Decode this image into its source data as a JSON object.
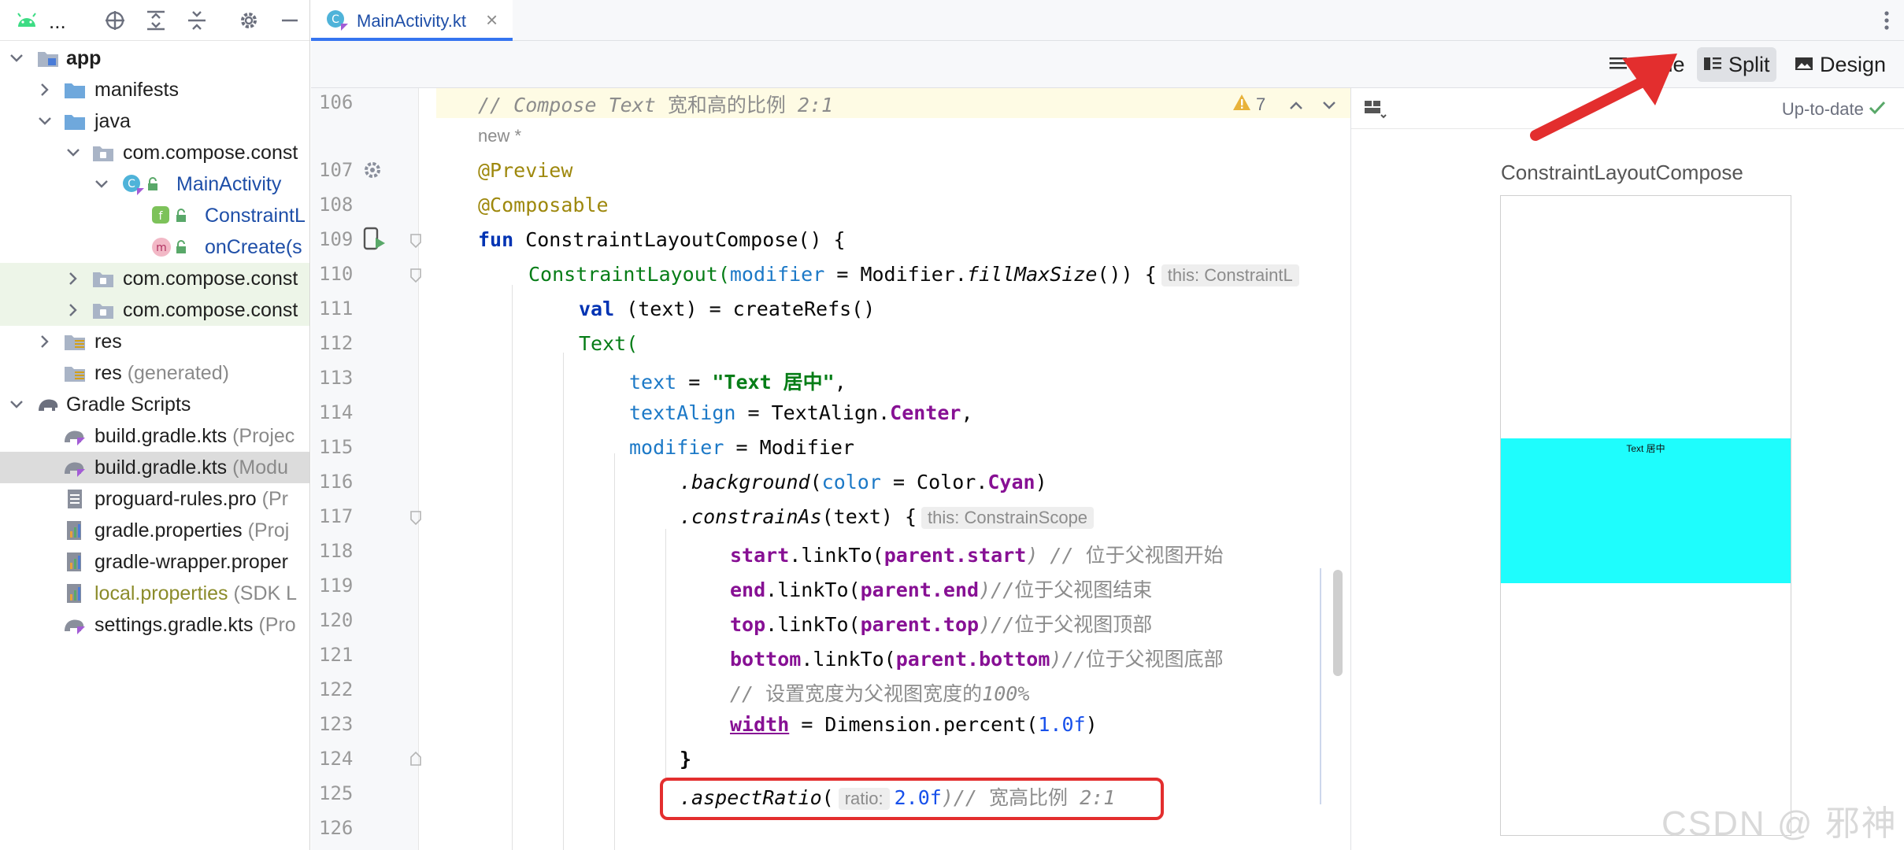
{
  "sidebar": {
    "project_label": "...",
    "tree": [
      {
        "label": "app",
        "sub": ""
      },
      {
        "label": "manifests",
        "sub": ""
      },
      {
        "label": "java",
        "sub": ""
      },
      {
        "label": "com.compose.const",
        "sub": ""
      },
      {
        "label": "MainActivity",
        "sub": ""
      },
      {
        "label": "ConstraintL",
        "sub": ""
      },
      {
        "label": "onCreate(s",
        "sub": ""
      },
      {
        "label": "com.compose.const",
        "sub": ""
      },
      {
        "label": "com.compose.const",
        "sub": ""
      },
      {
        "label": "res",
        "sub": ""
      },
      {
        "label": "res",
        "sub": "(generated)"
      },
      {
        "label": "Gradle Scripts",
        "sub": ""
      },
      {
        "label": "build.gradle.kts",
        "sub": "(Projec"
      },
      {
        "label": "build.gradle.kts",
        "sub": "(Modu"
      },
      {
        "label": "proguard-rules.pro",
        "sub": "(Pr"
      },
      {
        "label": "gradle.properties",
        "sub": "(Proj"
      },
      {
        "label": "gradle-wrapper.proper",
        "sub": ""
      },
      {
        "label": "local.properties",
        "sub": "(SDK L"
      },
      {
        "label": "settings.gradle.kts",
        "sub": "(Pro"
      }
    ]
  },
  "tabs": {
    "active": "MainActivity.kt",
    "close": "×"
  },
  "modes": {
    "code": "Code",
    "split": "Split",
    "design": "Design"
  },
  "editor": {
    "new_star": "new *",
    "warning_count": "7",
    "line_numbers": [
      "106",
      "107",
      "108",
      "109",
      "110",
      "111",
      "112",
      "113",
      "114",
      "115",
      "116",
      "117",
      "118",
      "119",
      "120",
      "121",
      "122",
      "123",
      "124",
      "125",
      "126"
    ],
    "l106_comment": "// Compose Text ",
    "l106_cn": "宽和高的比例",
    "l106_tail": " 2:1",
    "l107": "@Preview",
    "l108": "@Composable",
    "l109_kw": "fun",
    "l109_rest": " ConstraintLayoutCompose() {",
    "l110_fn": "ConstraintLayout(",
    "l110_param": "modifier",
    "l110_eq": " = Modifier.",
    "l110_call": "fillMaxSize",
    "l110_end": "()) {",
    "l110_hint": "this: ConstraintL",
    "l111_kw": "val",
    "l111_rest": " (text) = createRefs()",
    "l112_fn": "Text(",
    "l113_param": "text",
    "l113_eq": " = ",
    "l113_str": "\"Text 居中\"",
    "l113_end": ",",
    "l114_param": "textAlign",
    "l114_eq": " = TextAlign.",
    "l114_prop": "Center",
    "l114_end": ",",
    "l115_param": "modifier",
    "l115_eq": " = Modifier",
    "l116_call": ".background",
    "l116_open": "(",
    "l116_param": "color",
    "l116_eq": " = Color.",
    "l116_prop": "Cyan",
    "l116_close": ")",
    "l117_call": ".constrainAs",
    "l117_rest": "(text) {",
    "l117_hint": "this: ConstrainScope",
    "l118_a": "start",
    "l118_b": ".linkTo(",
    "l118_c": "parent.start",
    "l118_d": ") // ",
    "l118_cn": "位于父视图开始",
    "l119_a": "end",
    "l119_b": ".linkTo(",
    "l119_c": "parent.end",
    "l119_d": ")//",
    "l119_cn": "位于父视图结束",
    "l120_a": "top",
    "l120_b": ".linkTo(",
    "l120_c": "parent.top",
    "l120_d": ")//",
    "l120_cn": "位于父视图顶部",
    "l121_a": "bottom",
    "l121_b": ".linkTo(",
    "l121_c": "parent.bottom",
    "l121_d": ")//",
    "l121_cn": "位于父视图底部",
    "l122_c": "// ",
    "l122_cn": "设置宽度为父视图宽度的",
    "l122_pct": "100%",
    "l123_a": "width",
    "l123_b": " = Dimension.percent(",
    "l123_num": "1.0f",
    "l123_c": ")",
    "l124": "}",
    "l125_call": ".aspectRatio",
    "l125_open": "(",
    "l125_hint": "ratio:",
    "l125_num": "2.0f",
    "l125_close": ")// ",
    "l125_cn": "宽高比例",
    "l125_tail": " 2:1"
  },
  "preview": {
    "status": "Up-to-date",
    "title": "ConstraintLayoutCompose",
    "cyan_text": "Text 居中"
  },
  "watermark": "CSDN @ 邪神",
  "colors": {
    "accent": "#3574f0",
    "cyan": "#1efdfd",
    "annotation_red": "#e32e2e"
  }
}
